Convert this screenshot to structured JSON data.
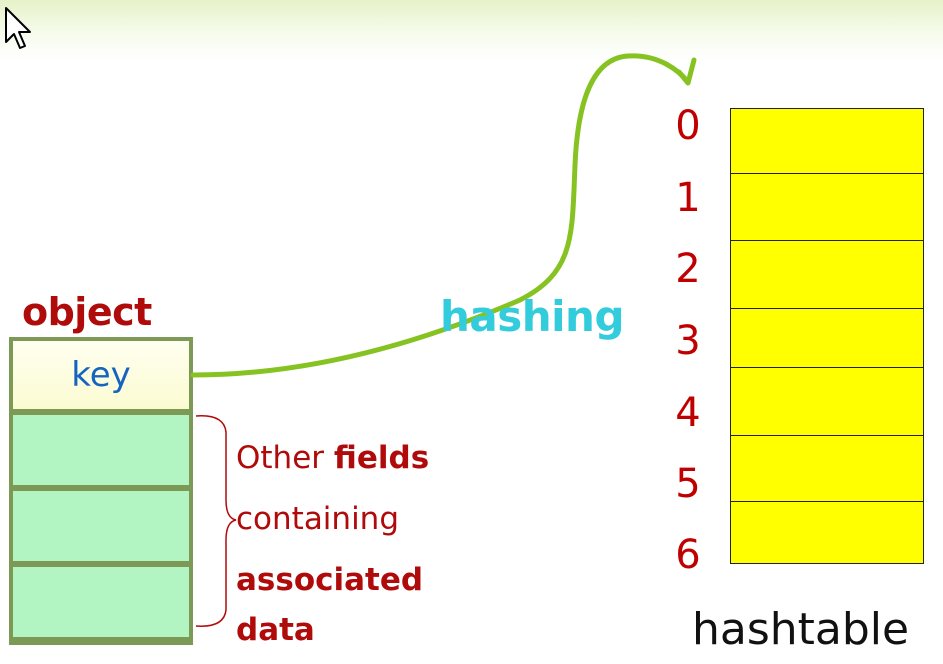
{
  "object": {
    "title": "object",
    "key_label": "key",
    "field_count": 3
  },
  "description": {
    "line1_normal": "Other ",
    "line1_bold": "fields",
    "line2": "containing",
    "line3": "associated",
    "line4": "data"
  },
  "arrow_label": "hashing",
  "hashtable": {
    "label": "hashtable",
    "indices": [
      "0",
      "1",
      "2",
      "3",
      "4",
      "5",
      "6"
    ]
  },
  "colors": {
    "object_title": "#b00b0b",
    "key_text": "#1565c0",
    "field_fill": "#b3f5c2",
    "box_border": "#7c9a55",
    "hashing_text": "#33ccdd",
    "arrow": "#86c322",
    "index_text": "#c00000",
    "slot_fill": "#ffff00"
  },
  "icons": {
    "cursor": "mouse-pointer-icon"
  }
}
